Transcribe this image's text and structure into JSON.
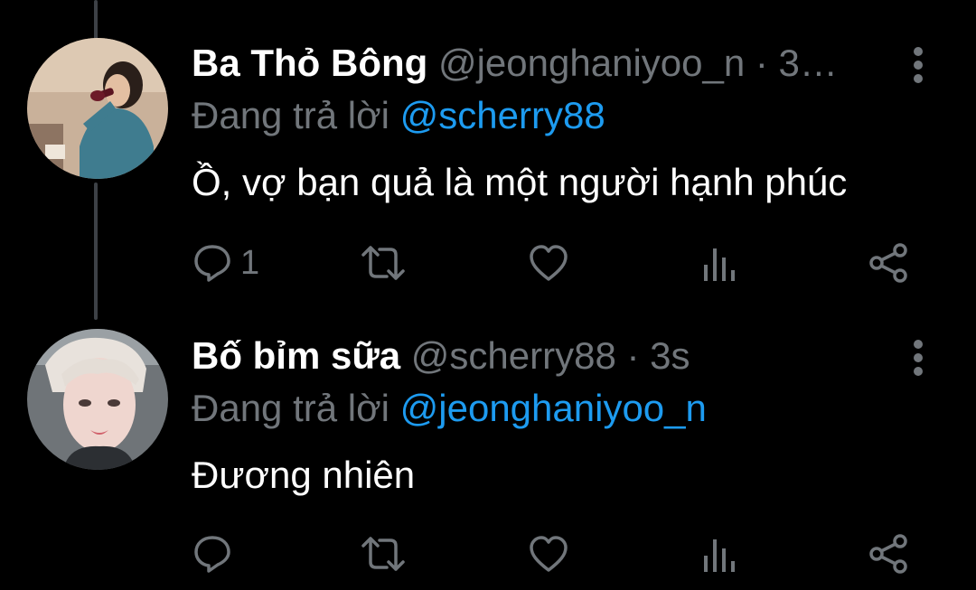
{
  "tweets": [
    {
      "display_name": "Ba Thỏ Bông",
      "handle": "@jeonghaniyoo_n",
      "separator": " · ",
      "time": "3…",
      "replying_label": "Đang trả lời",
      "replying_to": "@scherry88",
      "text": "Ồ, vợ bạn quả là một người hạnh phúc",
      "reply_count": "1",
      "avatar": "avatar-woman-drinking-wine"
    },
    {
      "display_name": "Bố bỉm sữa",
      "handle": "@scherry88",
      "separator": " · ",
      "time": "3s",
      "replying_label": "Đang trả lời",
      "replying_to": "@jeonghaniyoo_n",
      "text": "Đương nhiên",
      "reply_count": "",
      "avatar": "avatar-young-man-selfie"
    }
  ],
  "colors": {
    "background": "#000000",
    "text": "#ffffff",
    "secondary": "#71767b",
    "mention": "#1d9bf0",
    "thread_line": "#3d4146"
  },
  "icons": [
    "reply-icon",
    "retweet-icon",
    "like-icon",
    "views-icon",
    "share-icon",
    "more-icon"
  ]
}
